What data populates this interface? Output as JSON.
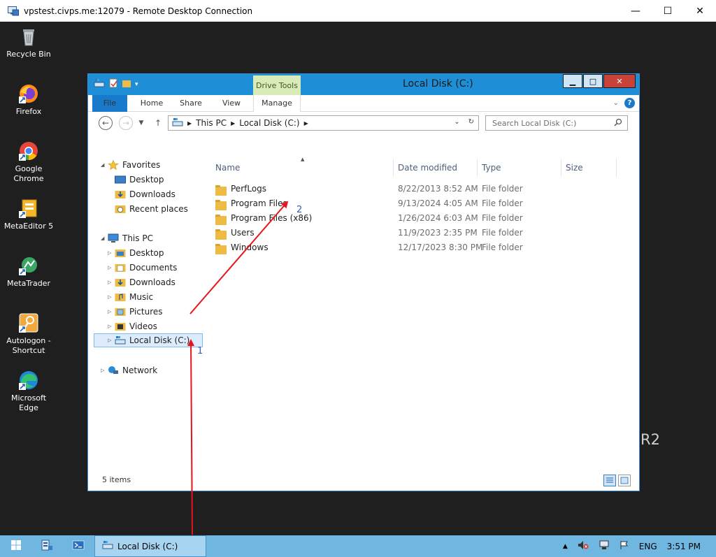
{
  "rdp": {
    "title": "vpstest.civps.me:12079 - Remote Desktop Connection",
    "minimize": "—",
    "maximize": "☐",
    "close": "✕"
  },
  "desktop": {
    "icons": [
      {
        "label": "Recycle Bin",
        "icon": "recycle-bin-icon"
      },
      {
        "label": "Firefox",
        "icon": "firefox-icon"
      },
      {
        "label": "Google Chrome",
        "icon": "chrome-icon"
      },
      {
        "label": "MetaEditor 5",
        "icon": "metaeditor-icon"
      },
      {
        "label": "MetaTrader",
        "icon": "metatrader-icon"
      },
      {
        "label": "Autologon - Shortcut",
        "icon": "autologon-icon"
      },
      {
        "label": "Microsoft Edge",
        "icon": "edge-icon"
      }
    ],
    "watermark": "R2"
  },
  "explorer": {
    "title": "Local Disk (C:)",
    "contextual_tab": "Drive Tools",
    "tabs": {
      "file": "File",
      "home": "Home",
      "share": "Share",
      "view": "View",
      "manage": "Manage"
    },
    "window_buttons": {
      "minimize": "▁",
      "maximize": "□",
      "close": "✕"
    },
    "help": "?",
    "address": {
      "crumbs": [
        "This PC",
        "Local Disk (C:)"
      ]
    },
    "search": {
      "placeholder": "Search Local Disk (C:)"
    },
    "nav": {
      "favorites": "Favorites",
      "fav_items": [
        "Desktop",
        "Downloads",
        "Recent places"
      ],
      "this_pc": "This PC",
      "pc_items": [
        "Desktop",
        "Documents",
        "Downloads",
        "Music",
        "Pictures",
        "Videos",
        "Local Disk (C:)"
      ],
      "network": "Network"
    },
    "columns": {
      "name": "Name",
      "date": "Date modified",
      "type": "Type",
      "size": "Size"
    },
    "files": [
      {
        "name": "PerfLogs",
        "date": "8/22/2013 8:52 AM",
        "type": "File folder"
      },
      {
        "name": "Program Files",
        "date": "9/13/2024 4:05 AM",
        "type": "File folder"
      },
      {
        "name": "Program Files (x86)",
        "date": "1/26/2024 6:03 AM",
        "type": "File folder"
      },
      {
        "name": "Users",
        "date": "11/9/2023 2:35 PM",
        "type": "File folder"
      },
      {
        "name": "Windows",
        "date": "12/17/2023 8:30 PM",
        "type": "File folder"
      }
    ],
    "status": "5 items"
  },
  "taskbar": {
    "explorer_label": "Local Disk (C:)",
    "language": "ENG",
    "time": "3:51 PM"
  },
  "annotations": {
    "one": "1",
    "two": "2",
    "arrow_color": "#e8141c"
  }
}
